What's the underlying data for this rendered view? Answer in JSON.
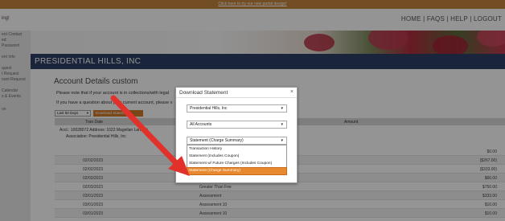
{
  "banner": {
    "link_text": "Click here to try our new portal design!"
  },
  "header": {
    "logo_text": "ing!",
    "nav": [
      "HOME",
      "FAQS",
      "HELP",
      "LOGOUT"
    ],
    "separator": "|"
  },
  "sidebar": {
    "items": [
      {
        "label": "ent Contact"
      },
      {
        "label": "ed"
      },
      {
        "label": "Password"
      },
      {
        "label": "ent Info"
      },
      {
        "label": "quest"
      },
      {
        "label": "t Request"
      },
      {
        "label": "ount Request"
      },
      {
        "label": "Calendar"
      },
      {
        "label": "s & Events"
      },
      {
        "label": "on"
      }
    ]
  },
  "property": {
    "name": "PRESIDENTIAL HILLS, INC"
  },
  "content": {
    "title": "Account Details custom",
    "note1": "Please note that if your account is in collections/with legal",
    "note2": "If you have a question about your current account, please v",
    "filter_value": "Last 60 Days",
    "download_button": "Download Statement",
    "columns": {
      "date": "Tran Date",
      "amount": "Amount"
    },
    "account_line": "Acct.: 10028072   Address: 1022 Magellan Lane St",
    "association_line": "Association: Presidential Hills, Inc",
    "rows": [
      {
        "date": "",
        "desc": "",
        "amount": "$0.00"
      },
      {
        "date": "02/02/2023",
        "desc": "",
        "amount": "($267.00)"
      },
      {
        "date": "02/02/2023",
        "desc": "",
        "amount": "($333.00)"
      },
      {
        "date": "02/03/2023",
        "desc": "",
        "amount": "$66.00"
      },
      {
        "date": "02/03/2023",
        "desc": "Greater Than Fee",
        "amount": "$750.00"
      },
      {
        "date": "03/01/2023",
        "desc": "Assessment",
        "amount": "$333.00"
      },
      {
        "date": "03/01/2023",
        "desc": "Assessment 10",
        "amount": "$10.00"
      },
      {
        "date": "03/01/2023",
        "desc": "Assessment 10",
        "amount": "$10.00"
      }
    ]
  },
  "modal": {
    "title": "Download Statement",
    "close": "×",
    "association_select": "Presidential Hills, Inc",
    "accounts_select": "All Accounts",
    "statement_select": "Statement (Charge Summary)",
    "options": [
      "Transaction History",
      "Statement (Includes Coupon)",
      "Statement w/ Future Charges (Includes Coupon)",
      "Statement (Charge Summary)"
    ],
    "selected_index": 3
  },
  "colors": {
    "banner": "#c7863e",
    "property_bar": "#2e3f64",
    "accent_orange": "#e8892f",
    "arrow_red": "#e2312b"
  },
  "icons": {
    "arrow": "red-arrow-icon",
    "caret": "chevron-down-icon"
  }
}
